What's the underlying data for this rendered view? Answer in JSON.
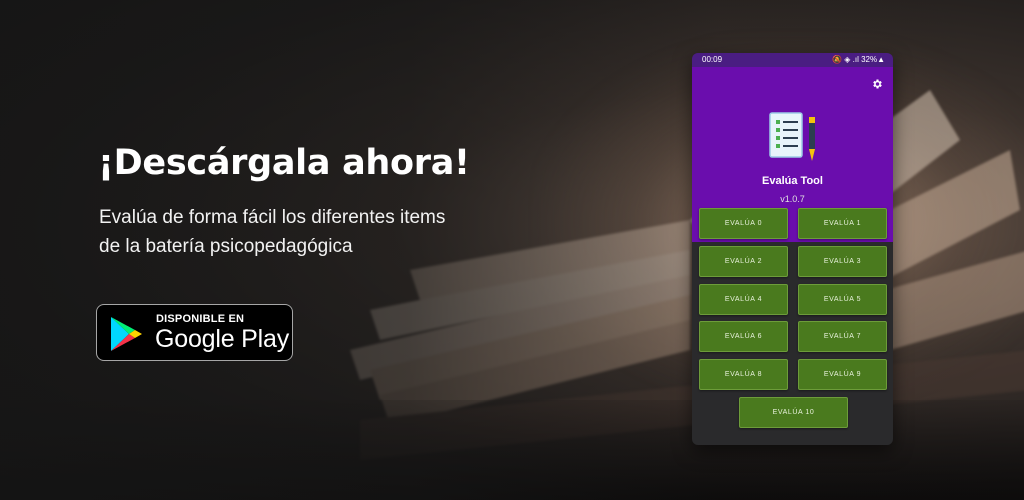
{
  "banner": {
    "headline": "¡Descárgala ahora!",
    "subtitle_line1": "Evalúa de forma fácil los diferentes items",
    "subtitle_line2": "de la batería psicopedagógica"
  },
  "store_badge": {
    "small_text": "DISPONIBLE EN",
    "big_text": "Google Play",
    "icon": "google-play-icon"
  },
  "phone": {
    "status_bar": {
      "time": "00:09",
      "right": "🔕 ◈ .ıl 32%▲"
    },
    "app_name": "Evalúa Tool",
    "version": "v1.0.7",
    "buttons": [
      "EVALÚA 0",
      "EVALÚA 1",
      "EVALÚA 2",
      "EVALÚA 3",
      "EVALÚA 4",
      "EVALÚA 5",
      "EVALÚA 6",
      "EVALÚA 7",
      "EVALÚA 8",
      "EVALÚA 9",
      "EVALÚA 10"
    ]
  },
  "colors": {
    "header_purple": "#6a0dad",
    "button_green": "#4a7a1e",
    "phone_bg": "#2a2a2c"
  }
}
